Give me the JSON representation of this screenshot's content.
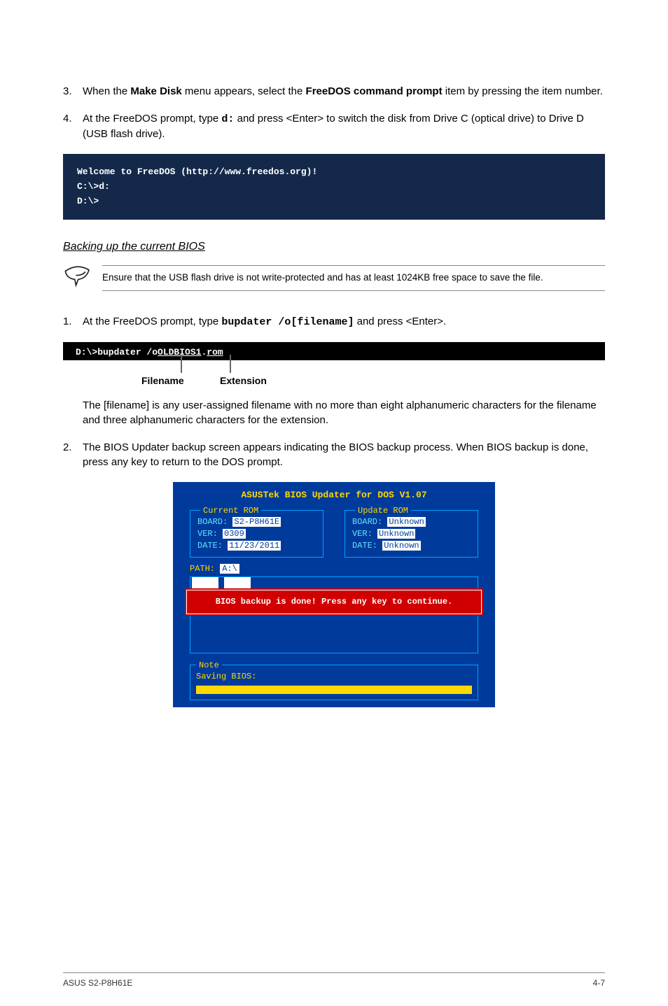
{
  "steps_a": [
    {
      "num": "3.",
      "pre": "When the ",
      "b1": "Make Disk",
      "mid": " menu appears, select the ",
      "b2": "FreeDOS command prompt",
      "post": " item by pressing the item number."
    },
    {
      "num": "4.",
      "text_pre": "At the FreeDOS prompt, type ",
      "code": "d:",
      "text_mid": " and press <Enter> to switch the disk from Drive C (optical drive) to Drive D (USB flash drive)."
    }
  ],
  "terminal": {
    "l1": "Welcome to FreeDOS (http://www.freedos.org)!",
    "l2": "C:\\>d:",
    "l3": "D:\\>"
  },
  "section_heading": "Backing up the current BIOS",
  "note_text": "Ensure that the USB flash drive is not write-protected and has at least 1024KB free space to save the file.",
  "step_b1": {
    "num": "1.",
    "pre": "At the FreeDOS prompt, type ",
    "code": "bupdater /o[filename]",
    "post": " and press <Enter>."
  },
  "cmd_line": {
    "prefix": "D:\\>bupdater /o",
    "file": "OLDBIOS1",
    "dot": ".",
    "ext": "rom"
  },
  "callouts": {
    "filename": "Filename",
    "extension": "Extension"
  },
  "para_after_cmd": "The [filename] is any user-assigned filename with no more than eight alphanumeric characters for the filename and three alphanumeric characters for the extension.",
  "step_b2": {
    "num": "2.",
    "text": "The BIOS Updater backup screen appears indicating the BIOS backup process. When BIOS backup is done, press any key to return to the DOS prompt."
  },
  "bios": {
    "title": "ASUSTek BIOS Updater for DOS V1.07",
    "current": {
      "label": "Current ROM",
      "board_k": "BOARD:",
      "board_v": "S2-P8H61E",
      "ver_k": "VER:",
      "ver_v": "0309",
      "date_k": "DATE:",
      "date_v": "11/23/2011"
    },
    "update": {
      "label": "Update ROM",
      "board_k": "BOARD:",
      "board_v": "Unknown",
      "ver_k": "VER:",
      "ver_v": "Unknown",
      "date_k": "DATE:",
      "date_v": "Unknown"
    },
    "path_k": "PATH:",
    "path_v": "A:\\",
    "banner": "BIOS backup is done! Press any key to continue.",
    "note_label": "Note",
    "saving": "Saving BIOS:"
  },
  "footer": {
    "left": "ASUS S2-P8H61E",
    "right": "4-7"
  }
}
